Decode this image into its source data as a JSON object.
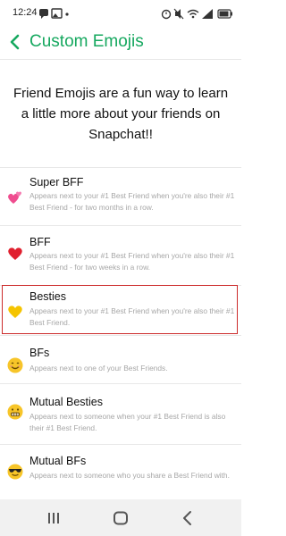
{
  "status_bar": {
    "time": "12:24",
    "left_icons": [
      "messaging-icon",
      "gallery-icon",
      "notification-dot-icon"
    ],
    "right_icons": [
      "alarm-icon",
      "mute-icon",
      "wifi-icon",
      "signal-icon",
      "battery-icon"
    ]
  },
  "header": {
    "title": "Custom Emojis",
    "accent_color": "#16a85f"
  },
  "intro": {
    "text": "Friend Emojis are a fun way to learn a little more about your friends on Snapchat!!"
  },
  "items": [
    {
      "emoji_icon": "two-hearts-emoji",
      "title": "Super BFF",
      "description": "Appears next to your #1 Best Friend when you're also their #1 Best Friend - for two months in a row."
    },
    {
      "emoji_icon": "red-heart-emoji",
      "title": "BFF",
      "description": "Appears next to your #1 Best Friend when you're also their #1 Best Friend - for two weeks in a row."
    },
    {
      "emoji_icon": "yellow-heart-emoji",
      "title": "Besties",
      "description": "Appears next to your #1 Best Friend when you're also their #1 Best Friend.",
      "selected": true,
      "highlight_color": "#cc2b2b"
    },
    {
      "emoji_icon": "smiling-face-emoji",
      "title": "BFs",
      "description": "Appears next to one of your Best Friends."
    },
    {
      "emoji_icon": "grimacing-face-emoji",
      "title": "Mutual Besties",
      "description": "Appears next to someone when your #1 Best Friend is also their #1 Best Friend."
    },
    {
      "emoji_icon": "sunglasses-face-emoji",
      "title": "Mutual BFs",
      "description": "Appears next to someone who you share a Best Friend with."
    }
  ],
  "nav_bar": {
    "buttons": [
      "recent-apps-icon",
      "home-icon",
      "back-icon"
    ]
  }
}
